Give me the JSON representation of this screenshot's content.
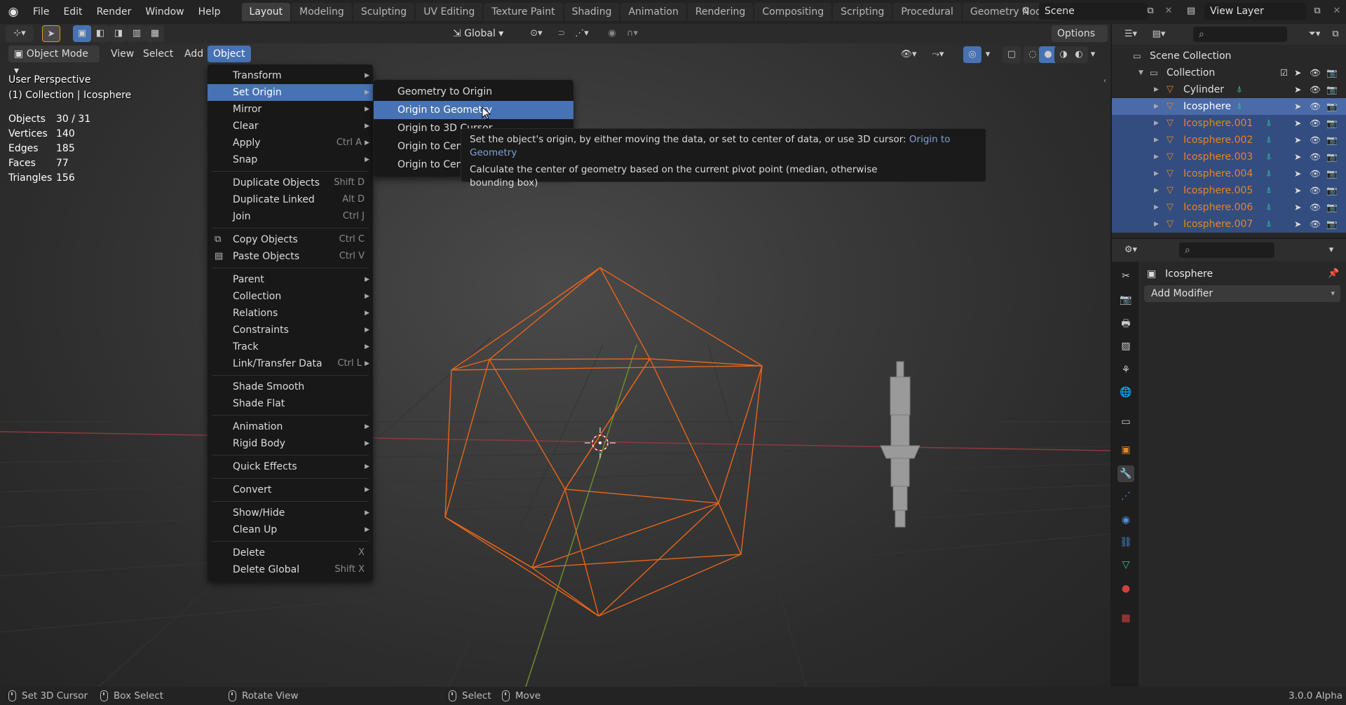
{
  "app": {
    "version": "3.0.0 Alpha",
    "top_menu": [
      "File",
      "Edit",
      "Render",
      "Window",
      "Help"
    ],
    "workspaces": [
      "Layout",
      "Modeling",
      "Sculpting",
      "UV Editing",
      "Texture Paint",
      "Shading",
      "Animation",
      "Rendering",
      "Compositing",
      "Scripting",
      "Procedural",
      "Geometry Nodes"
    ],
    "active_workspace": "Layout",
    "scene": "Scene",
    "view_layer": "View Layer"
  },
  "toolbar": {
    "orientation": "Global",
    "options_label": "Options"
  },
  "viewport_header": {
    "mode": "Object Mode",
    "menus": [
      "View",
      "Select",
      "Add",
      "Object"
    ],
    "active_menu": "Object"
  },
  "viewport": {
    "perspective": "User Perspective",
    "context": "(1) Collection | Icosphere",
    "stats": [
      {
        "label": "Objects",
        "value": "30 / 31"
      },
      {
        "label": "Vertices",
        "value": "140"
      },
      {
        "label": "Edges",
        "value": "185"
      },
      {
        "label": "Faces",
        "value": "77"
      },
      {
        "label": "Triangles",
        "value": "156"
      }
    ]
  },
  "object_menu": {
    "groups": [
      [
        {
          "label": "Transform",
          "submenu": true
        },
        {
          "label": "Set Origin",
          "submenu": true,
          "highlight": true
        },
        {
          "label": "Mirror",
          "submenu": true
        },
        {
          "label": "Clear",
          "submenu": true
        },
        {
          "label": "Apply",
          "shortcut": "Ctrl A",
          "submenu": true
        },
        {
          "label": "Snap",
          "submenu": true
        }
      ],
      [
        {
          "label": "Duplicate Objects",
          "shortcut": "Shift D"
        },
        {
          "label": "Duplicate Linked",
          "shortcut": "Alt D"
        },
        {
          "label": "Join",
          "shortcut": "Ctrl J"
        }
      ],
      [
        {
          "label": "Copy Objects",
          "shortcut": "Ctrl C",
          "icon": "copy-icon"
        },
        {
          "label": "Paste Objects",
          "shortcut": "Ctrl V",
          "icon": "paste-icon"
        }
      ],
      [
        {
          "label": "Parent",
          "submenu": true
        },
        {
          "label": "Collection",
          "submenu": true
        },
        {
          "label": "Relations",
          "submenu": true
        },
        {
          "label": "Constraints",
          "submenu": true
        },
        {
          "label": "Track",
          "submenu": true
        },
        {
          "label": "Link/Transfer Data",
          "shortcut": "Ctrl L",
          "submenu": true
        }
      ],
      [
        {
          "label": "Shade Smooth"
        },
        {
          "label": "Shade Flat"
        }
      ],
      [
        {
          "label": "Animation",
          "submenu": true
        },
        {
          "label": "Rigid Body",
          "submenu": true
        }
      ],
      [
        {
          "label": "Quick Effects",
          "submenu": true
        }
      ],
      [
        {
          "label": "Convert",
          "submenu": true
        }
      ],
      [
        {
          "label": "Show/Hide",
          "submenu": true
        },
        {
          "label": "Clean Up",
          "submenu": true
        }
      ],
      [
        {
          "label": "Delete",
          "shortcut": "X"
        },
        {
          "label": "Delete Global",
          "shortcut": "Shift X"
        }
      ]
    ]
  },
  "set_origin_submenu": {
    "items": [
      {
        "label": "Geometry to Origin"
      },
      {
        "label": "Origin to Geometry",
        "highlight": true
      },
      {
        "label": "Origin to 3D Cursor"
      },
      {
        "label": "Origin to Cente"
      },
      {
        "label": "Origin to Cente"
      }
    ]
  },
  "tooltip": {
    "line1": "Set the object's origin, by either moving the data, or set to center of data, or use 3D cursor:",
    "line1_name": "Origin to Geometry",
    "line2": "Calculate the center of geometry based on the current pivot point (median, otherwise",
    "line3": "bounding box)"
  },
  "outliner": {
    "root": "Scene Collection",
    "collection": "Collection",
    "objects": [
      {
        "name": "Cylinder",
        "selected": false
      },
      {
        "name": "Icosphere",
        "selected": true,
        "active": true
      },
      {
        "name": "Icosphere.001",
        "selected": true
      },
      {
        "name": "Icosphere.002",
        "selected": true
      },
      {
        "name": "Icosphere.003",
        "selected": true
      },
      {
        "name": "Icosphere.004",
        "selected": true
      },
      {
        "name": "Icosphere.005",
        "selected": true
      },
      {
        "name": "Icosphere.006",
        "selected": true
      },
      {
        "name": "Icosphere.007",
        "selected": true
      }
    ]
  },
  "properties": {
    "object_name": "Icosphere",
    "add_modifier": "Add Modifier"
  },
  "statusbar": {
    "items": [
      "Set 3D Cursor",
      "Box Select",
      "Rotate View",
      "Select",
      "Move"
    ]
  },
  "colors": {
    "accent": "#4772b3",
    "selected_orange": "#e8851e",
    "wire_orange": "#e8651a"
  }
}
